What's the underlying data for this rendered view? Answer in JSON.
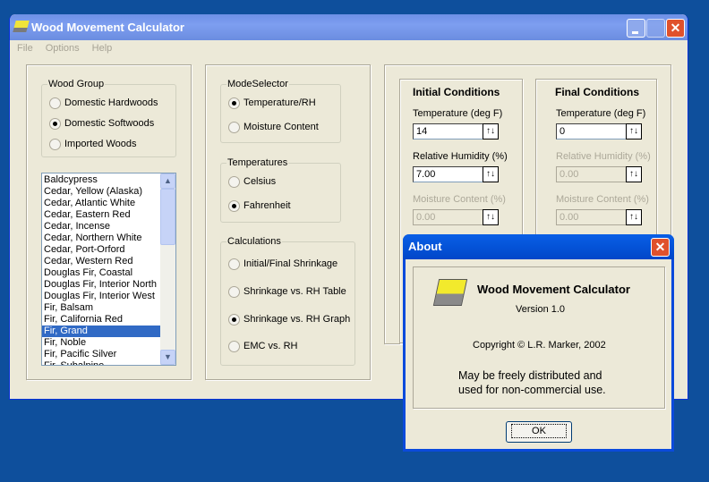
{
  "window": {
    "title": "Wood Movement Calculator",
    "menu": [
      "File",
      "Options",
      "Help"
    ]
  },
  "wood_group": {
    "label": "Wood Group",
    "options": [
      "Domestic Hardwoods",
      "Domestic Softwoods",
      "Imported Woods"
    ],
    "selected": 1
  },
  "species_list": {
    "items": [
      "Baldcypress",
      "Cedar, Yellow (Alaska)",
      "Cedar, Atlantic White",
      "Cedar, Eastern Red",
      "Cedar, Incense",
      "Cedar, Northern White",
      "Cedar, Port-Orford",
      "Cedar, Western Red",
      "Douglas Fir, Coastal",
      "Douglas Fir, Interior North",
      "Douglas Fir, Interior West",
      "Fir, Balsam",
      "Fir, California Red",
      "Fir, Grand",
      "Fir, Noble",
      "Fir, Pacific Silver",
      "Fir, Subalpine"
    ],
    "selected": 13
  },
  "mode_selector": {
    "label": "ModeSelector",
    "options": [
      "Temperature/RH",
      "Moisture Content"
    ],
    "selected": 0
  },
  "temperatures": {
    "label": "Temperatures",
    "options": [
      "Celsius",
      "Fahrenheit"
    ],
    "selected": 1
  },
  "calculations": {
    "label": "Calculations",
    "options": [
      "Initial/Final Shrinkage",
      "Shrinkage vs. RH Table",
      "Shrinkage vs. RH Graph",
      "EMC vs. RH"
    ],
    "selected": 2
  },
  "initial": {
    "title": "Initial Conditions",
    "temp_label": "Temperature (deg F)",
    "temp": "14",
    "rh_label": "Relative Humidity (%)",
    "rh": "7.00",
    "mc_label": "Moisture Content (%)",
    "mc": "0.00"
  },
  "final": {
    "title": "Final Conditions",
    "temp_label": "Temperature (deg F)",
    "temp": "0",
    "rh_label": "Relative Humidity (%)",
    "rh": "0.00",
    "mc_label": "Moisture Content (%)",
    "mc": "0.00"
  },
  "about": {
    "title": "About",
    "app_name": "Wood Movement Calculator",
    "version": "Version 1.0",
    "copyright": "Copyright © L.R. Marker, 2002",
    "line1": "May be freely distributed and",
    "line2": "used for non-commercial use.",
    "ok": "OK"
  }
}
